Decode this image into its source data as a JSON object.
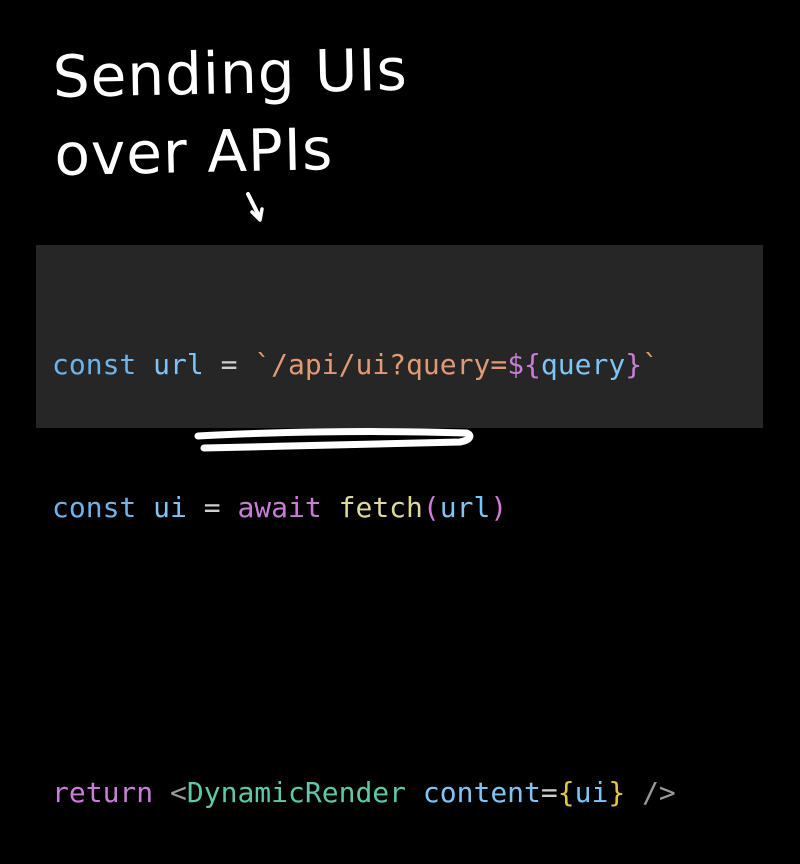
{
  "title": {
    "line1": "Sending UIs",
    "line2": "over APIs"
  },
  "code": {
    "line1": {
      "kw": "const",
      "var": "url",
      "op": "=",
      "str_open": "`/api/ui?query=",
      "interp_open": "${",
      "interp_var": "query",
      "interp_close": "}",
      "str_close": "`"
    },
    "line2": {
      "kw": "const",
      "var": "ui",
      "op": "=",
      "await": "await",
      "fn": "fetch",
      "paren_open": "(",
      "arg": "url",
      "paren_close": ")"
    },
    "line4": {
      "kw": "return",
      "lt": "<",
      "component": "DynamicRender",
      "attr": "content",
      "eq": "=",
      "brace_open": "{",
      "value": "ui",
      "brace_close": "}",
      "close": "/>"
    }
  },
  "colors": {
    "background": "#000000",
    "code_panel": "#262626",
    "keyword": "#6fb3e8",
    "string": "#e09a76",
    "component": "#5ec8a8",
    "control": "#c77fd6",
    "function": "#dcd99a",
    "brace": "#e0c64a"
  }
}
